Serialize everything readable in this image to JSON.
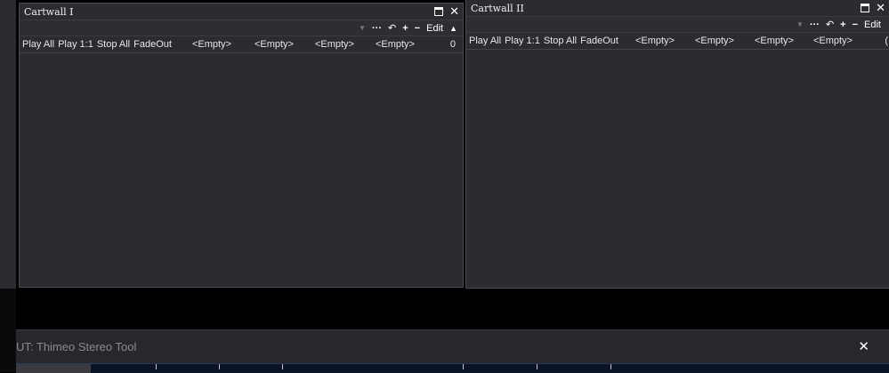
{
  "panels": [
    {
      "title": "Cartwall I",
      "toolbar": {
        "menu": "···",
        "undo": "↶",
        "add": "+",
        "remove": "−",
        "edit": "Edit",
        "collapse": "▲"
      },
      "row": {
        "play_all": "Play All",
        "play_1_1": "Play 1:1",
        "stop_all": "Stop All",
        "fadeout": "FadeOut",
        "slots": [
          "<Empty>",
          "<Empty>",
          "<Empty>",
          "<Empty>"
        ],
        "count": "0"
      }
    },
    {
      "title": "Cartwall II",
      "toolbar": {
        "menu": "···",
        "undo": "↶",
        "add": "+",
        "remove": "−",
        "edit": "Edit",
        "collapse": "▲"
      },
      "row": {
        "play_all": "Play All",
        "play_1_1": "Play 1:1",
        "stop_all": "Stop All",
        "fadeout": "FadeOut",
        "slots": [
          "<Empty>",
          "<Empty>",
          "<Empty>",
          "<Empty>"
        ],
        "count": "("
      }
    }
  ],
  "bottom": {
    "title": "UT: Thimeo Stereo Tool",
    "close": "✕"
  },
  "icons": {
    "maximize": "maximize-icon",
    "close": "close-icon",
    "dropdown": "chevron-down-icon",
    "menu": "more-icon",
    "undo": "undo-icon",
    "add": "plus-icon",
    "remove": "minus-icon",
    "collapse": "chevron-up-icon"
  }
}
